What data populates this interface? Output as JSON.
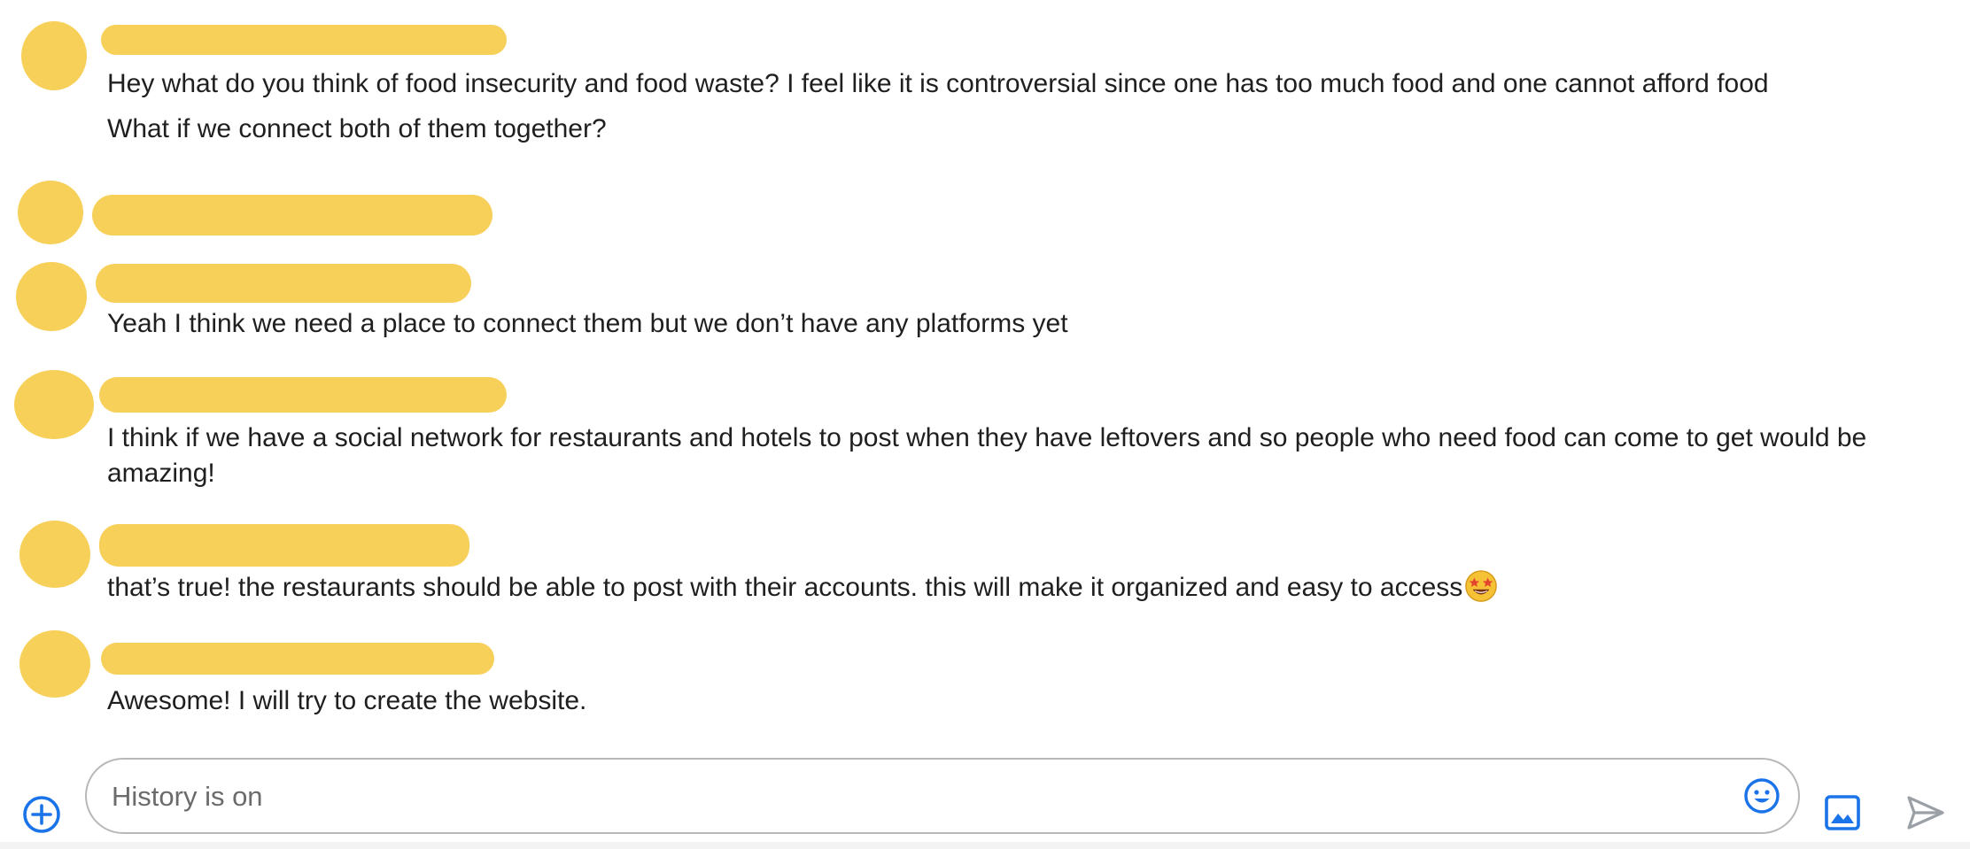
{
  "messages": [
    {
      "text": "Hey what do you think of food insecurity and food waste? I feel like it is controversial since one has too much food and one cannot afford food"
    },
    {
      "text": "What if we connect both of them together?"
    },
    {
      "text": "Yeah I think we need a place to connect them but we don’t have any platforms yet"
    },
    {
      "text": "I think if we have a social network for restaurants and hotels to post when they have leftovers and so people who need food can come to get would be amazing!"
    },
    {
      "text": "that’s true! the restaurants should be able to post with their accounts. this will make it organized and easy to access"
    },
    {
      "text": "Awesome! I will try to create the website."
    }
  ],
  "composer": {
    "placeholder": "History is on"
  },
  "icons": {
    "add": "plus-circle-icon",
    "emoji": "smiley-icon",
    "image": "image-icon",
    "send": "send-icon",
    "message_emoji": "star-struck-emoji"
  },
  "colors": {
    "accent": "#1a73e8",
    "redaction": "#f7d05a",
    "send_disabled": "#9aa0a6"
  }
}
